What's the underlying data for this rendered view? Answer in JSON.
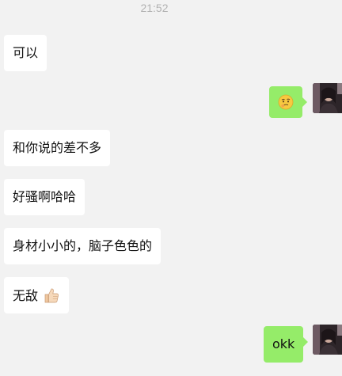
{
  "chat": {
    "timestamp": "21:52",
    "messages": [
      {
        "side": "left",
        "text": "可以"
      },
      {
        "side": "right",
        "emoji": "thinking-face-emoji",
        "text": ""
      },
      {
        "side": "left",
        "text": "和你说的差不多"
      },
      {
        "side": "left",
        "text": "好骚啊哈哈"
      },
      {
        "side": "left",
        "text": "身材小小的，脑子色色的"
      },
      {
        "side": "left",
        "text": "无敌",
        "emoji": "thumbs-up-emoji"
      },
      {
        "side": "right",
        "text": "okk"
      }
    ]
  },
  "colors": {
    "background": "#f2f2f2",
    "incoming_bubble": "#ffffff",
    "outgoing_bubble": "#95ec69",
    "timestamp_text": "#b2b2b2"
  }
}
